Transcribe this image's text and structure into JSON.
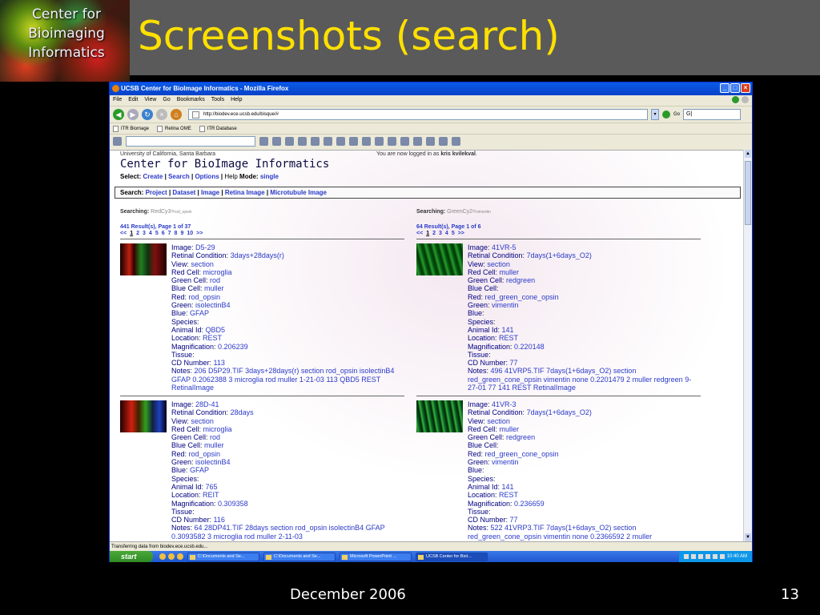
{
  "slide": {
    "logo_lines": [
      "Center for",
      "Bioimaging",
      "Informatics"
    ],
    "title": "Screenshots (search)",
    "date": "December 2006",
    "page_number": "13"
  },
  "browser": {
    "window_title": "UCSB Center for BioImage Informatics - Mozilla Firefox",
    "menu": [
      "File",
      "Edit",
      "View",
      "Go",
      "Bookmarks",
      "Tools",
      "Help"
    ],
    "url": "http://biodev.ece.ucsb.edu/bisque/#",
    "go_label": "Go",
    "search_value": "G|",
    "bookmarks": [
      "ITR Biomage",
      "Retina OME",
      "ITR Database"
    ],
    "status": "Transferring data from biodev.ece.ucsb.edu..."
  },
  "site": {
    "university": "University of California, Santa Barbara",
    "login_prefix": "You are now logged in as",
    "login_user": "kris kvilekval",
    "header": "Center for BioImage Informatics",
    "select_label": "Select:",
    "select_links": [
      "Create",
      "Search",
      "Options"
    ],
    "help_label": "Help",
    "mode_label": "Mode:",
    "mode_value": "single",
    "search_label": "Search:",
    "search_links": [
      "Project",
      "Dataset",
      "Image",
      "Retina Image",
      "Microtubule Image"
    ]
  },
  "columns": [
    {
      "searching_label": "Searching",
      "query_name": "RedCy3",
      "query_value": "rod_opsin",
      "results": "441 Result(s), Page 1 of 37",
      "pages": [
        "<<",
        "1",
        "2",
        "3",
        "4",
        "5",
        "6",
        "7",
        "8",
        "9",
        "10",
        ">>"
      ],
      "current_page": "1",
      "records": [
        {
          "fields": [
            [
              "Image",
              "D5-29"
            ],
            [
              "Retinal Condition",
              "3days+28days(r)"
            ],
            [
              "View",
              "section"
            ],
            [
              "Red Cell",
              "microglia"
            ],
            [
              "Green Cell",
              "rod"
            ],
            [
              "Blue Cell",
              "muller"
            ],
            [
              "Red",
              "rod_opsin"
            ],
            [
              "Green",
              "isolectinB4"
            ],
            [
              "Blue",
              "GFAP"
            ],
            [
              "Species",
              ""
            ],
            [
              "Animal Id",
              "QBD5"
            ],
            [
              "Location",
              "REST"
            ],
            [
              "Magnification",
              "0.206239"
            ],
            [
              "Tissue",
              ""
            ],
            [
              "CD Number",
              "113"
            ]
          ],
          "notes_label": "Notes",
          "notes": "206 D5P29.TIF 3days+28days(r) section rod_opsin isolectinB4 GFAP 0.2062388 3 microglia rod muller 1-21-03 113 QBD5 REST RetinalImage"
        },
        {
          "fields": [
            [
              "Image",
              "28D-41"
            ],
            [
              "Retinal Condition",
              "28days"
            ],
            [
              "View",
              "section"
            ],
            [
              "Red Cell",
              "microglia"
            ],
            [
              "Green Cell",
              "rod"
            ],
            [
              "Blue Cell",
              "muller"
            ],
            [
              "Red",
              "rod_opsin"
            ],
            [
              "Green",
              "isolectinB4"
            ],
            [
              "Blue",
              "GFAP"
            ],
            [
              "Species",
              ""
            ],
            [
              "Animal Id",
              "765"
            ],
            [
              "Location",
              "REIT"
            ],
            [
              "Magnification",
              "0.309358"
            ],
            [
              "Tissue",
              ""
            ],
            [
              "CD Number",
              "116"
            ]
          ],
          "notes_label": "Notes",
          "notes": "64 28DP41.TIF 28days section rod_opsin isolectinB4 GFAP 0.3093582 3 microglia rod muller 2-11-03"
        }
      ]
    },
    {
      "searching_label": "Searching",
      "query_name": "GreenCy2",
      "query_value": "vimentin",
      "results": "64 Result(s), Page 1 of 6",
      "pages": [
        "<<",
        "1",
        "2",
        "3",
        "4",
        "5",
        ">>"
      ],
      "current_page": "1",
      "records": [
        {
          "fields": [
            [
              "Image",
              "41VR-5"
            ],
            [
              "Retinal Condition",
              "7days(1+6days_O2)"
            ],
            [
              "View",
              "section"
            ],
            [
              "Red Cell",
              "muller"
            ],
            [
              "Green Cell",
              "redgreen"
            ],
            [
              "Blue Cell",
              ""
            ],
            [
              "Red",
              "red_green_cone_opsin"
            ],
            [
              "Green",
              "vimentin"
            ],
            [
              "Blue",
              ""
            ],
            [
              "Species",
              ""
            ],
            [
              "Animal Id",
              "141"
            ],
            [
              "Location",
              "REST"
            ],
            [
              "Magnification",
              "0.220148"
            ],
            [
              "Tissue",
              ""
            ],
            [
              "CD Number",
              "77"
            ]
          ],
          "notes_label": "Notes",
          "notes": "496 41VRP5.TIF 7days(1+6days_O2) section red_green_cone_opsin vimentin none 0.2201479 2 muller redgreen 9-27-01 77 141 REST RetinalImage"
        },
        {
          "fields": [
            [
              "Image",
              "41VR-3"
            ],
            [
              "Retinal Condition",
              "7days(1+6days_O2)"
            ],
            [
              "View",
              "section"
            ],
            [
              "Red Cell",
              "muller"
            ],
            [
              "Green Cell",
              "redgreen"
            ],
            [
              "Blue Cell",
              ""
            ],
            [
              "Red",
              "red_green_cone_opsin"
            ],
            [
              "Green",
              "vimentin"
            ],
            [
              "Blue",
              ""
            ],
            [
              "Species",
              ""
            ],
            [
              "Animal Id",
              "141"
            ],
            [
              "Location",
              "REST"
            ],
            [
              "Magnification",
              "0.236659"
            ],
            [
              "Tissue",
              ""
            ],
            [
              "CD Number",
              "77"
            ]
          ],
          "notes_label": "Notes",
          "notes": "522 41VRP3.TIF 7days(1+6days_O2) section red_green_cone_opsin vimentin none 0.2366592 2 muller"
        }
      ]
    }
  ],
  "taskbar": {
    "start_label": "start",
    "tasks": [
      "C:\\Documents and Se...",
      "C:\\Documents and Se...",
      "Microsoft PowerPoint ...",
      "UCSB Center for BioI..."
    ],
    "clock": "10:40 AM"
  }
}
